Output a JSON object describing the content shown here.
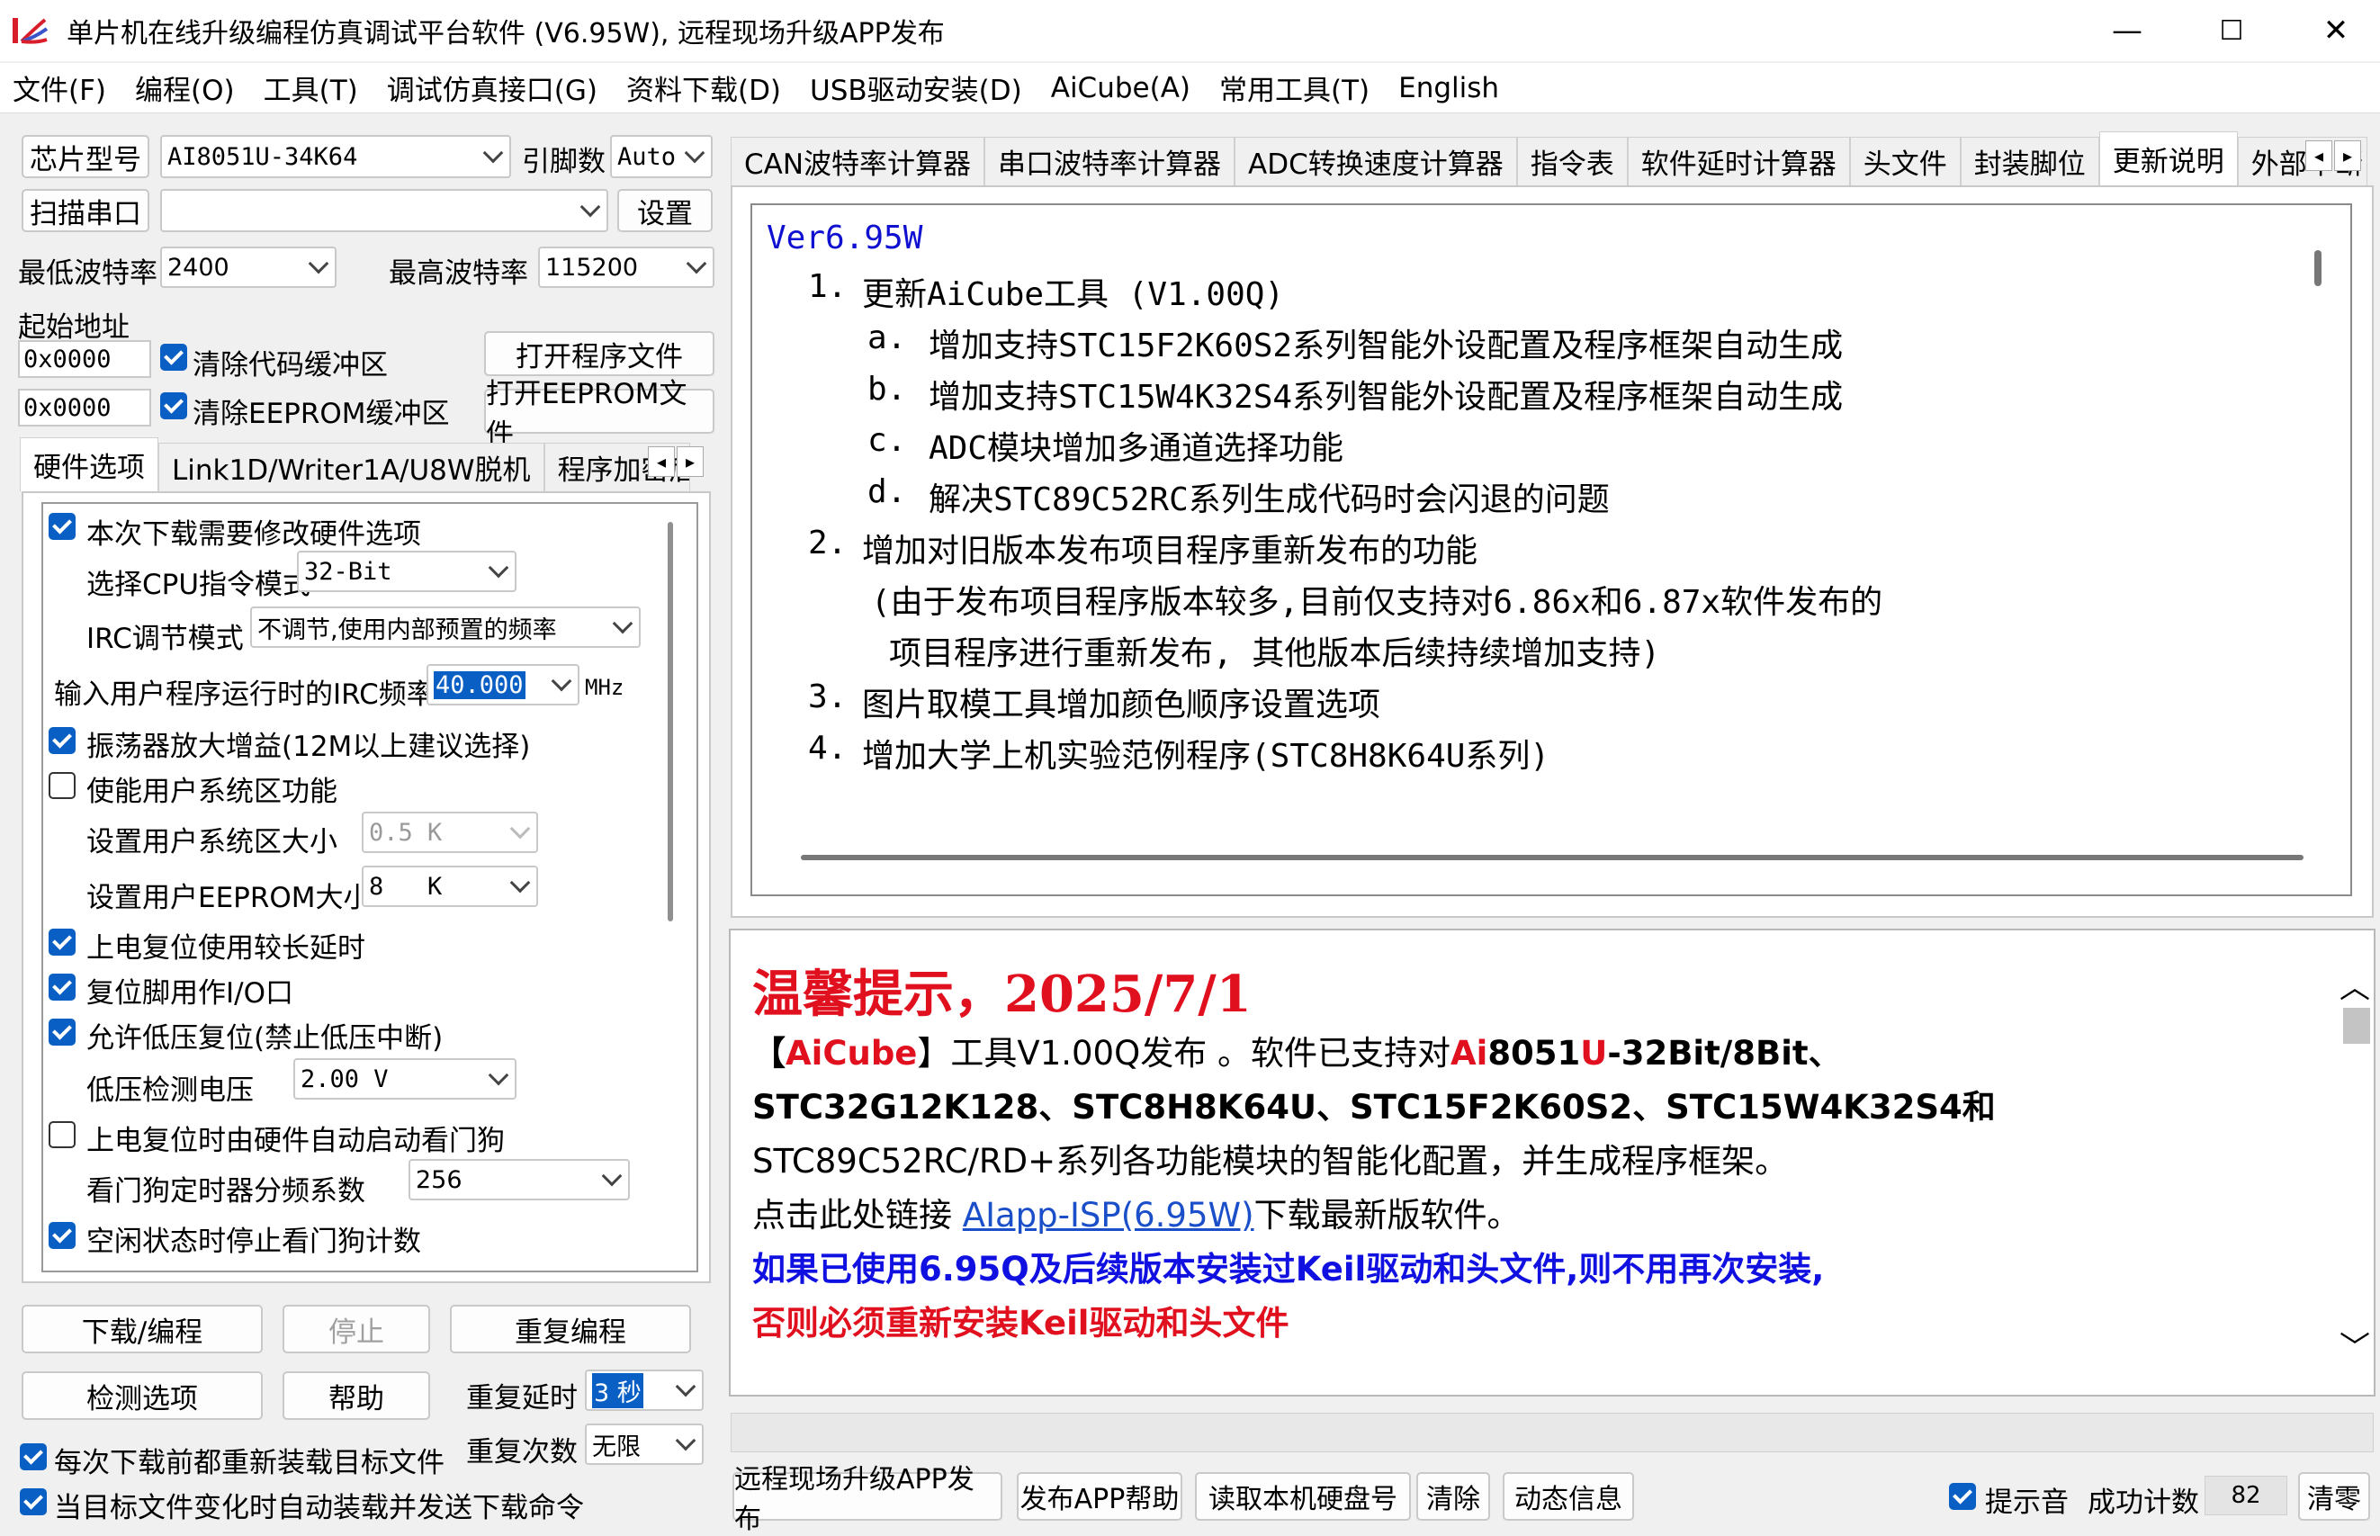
{
  "window": {
    "title": "单片机在线升级编程仿真调试平台软件 (V6.95W), 远程现场升级APP发布",
    "minimize": "—",
    "maximize": "☐",
    "close": "✕"
  },
  "menu": [
    "文件(F)",
    "编程(O)",
    "工具(T)",
    "调试仿真接口(G)",
    "资料下载(D)",
    "USB驱动安装(D)",
    "AiCube(A)",
    "常用工具(T)",
    "English"
  ],
  "left": {
    "chip_label": "芯片型号",
    "chip_value": "AI8051U-34K64",
    "pins_label": "引脚数",
    "pins_value": "Auto",
    "scan_label": "扫描串口",
    "port_value": "",
    "settings_label": "设置",
    "min_baud_label": "最低波特率",
    "min_baud_value": "2400",
    "max_baud_label": "最高波特率",
    "max_baud_value": "115200",
    "start_addr_label": "起始地址",
    "addr1": "0x0000",
    "addr2": "0x0000",
    "clear_code_label": "清除代码缓冲区",
    "clear_eeprom_label": "清除EEPROM缓冲区",
    "open_prog_label": "打开程序文件",
    "open_eeprom_label": "打开EEPROM文件",
    "tabs": [
      "硬件选项",
      "Link1D/Writer1A/U8W脱机",
      "程序加密后"
    ],
    "hw": {
      "modify_label": "本次下载需要修改硬件选项",
      "cpu_mode_label": "选择CPU指令模式",
      "cpu_mode_value": "32-Bit",
      "irc_adj_label": "IRC调节模式",
      "irc_adj_value": "不调节,使用内部预置的频率",
      "irc_freq_label": "输入用户程序运行时的IRC频率",
      "irc_freq_value": "40.000",
      "irc_freq_unit": "MHz",
      "osc_gain_label": "振荡器放大增益(12M以上建议选择)",
      "user_sys_label": "使能用户系统区功能",
      "user_sys_size_label": "设置用户系统区大小",
      "user_sys_size_value": "0.5 K",
      "eeprom_size_label": "设置用户EEPROM大小",
      "eeprom_size_value": "8   K",
      "long_reset_label": "上电复位使用较长延时",
      "reset_pin_label": "复位脚用作I/O口",
      "low_volt_reset_label": "允许低压复位(禁止低压中断)",
      "low_volt_label": "低压检测电压",
      "low_volt_value": "2.00 V",
      "wdt_auto_label": "上电复位时由硬件自动启动看门狗",
      "wdt_div_label": "看门狗定时器分频系数",
      "wdt_div_value": "256",
      "idle_wdt_label": "空闲状态时停止看门狗计数"
    },
    "download_label": "下载/编程",
    "stop_label": "停止",
    "reprogram_label": "重复编程",
    "check_label": "检测选项",
    "help_label": "帮助",
    "repeat_delay_label": "重复延时",
    "repeat_delay_value": "3 秒",
    "repeat_count_label": "重复次数",
    "repeat_count_value": "无限",
    "reload_label": "每次下载前都重新装载目标文件",
    "auto_send_label": "当目标文件变化时自动装载并发送下载命令"
  },
  "right_tabs": [
    "CAN波特率计算器",
    "串口波特率计算器",
    "ADC转换速度计算器",
    "指令表",
    "软件延时计算器",
    "头文件",
    "封装脚位",
    "更新说明",
    "外部中断"
  ],
  "changelog": {
    "version": "Ver6.95W",
    "lines": [
      {
        "num": "1.",
        "text": "更新AiCube工具 (V1.00Q)"
      },
      {
        "num": "a.",
        "text": "增加支持STC15F2K60S2系列智能外设配置及程序框架自动生成"
      },
      {
        "num": "b.",
        "text": "增加支持STC15W4K32S4系列智能外设配置及程序框架自动生成"
      },
      {
        "num": "c.",
        "text": "ADC模块增加多通道选择功能"
      },
      {
        "num": "d.",
        "text": "解决STC89C52RC系列生成代码时会闪退的问题"
      },
      {
        "num": "2.",
        "text": "增加对旧版本发布项目程序重新发布的功能"
      },
      {
        "num": "",
        "text": "(由于发布项目程序版本较多,目前仅支持对6.86x和6.87x软件发布的"
      },
      {
        "num": "",
        "text": "项目程序进行重新发布, 其他版本后续持续增加支持)"
      },
      {
        "num": "3.",
        "text": "图片取模工具增加颜色顺序设置选项"
      },
      {
        "num": "4.",
        "text": "增加大学上机实验范例程序(STC8H8K64U系列)"
      }
    ]
  },
  "notice": {
    "heading": "温馨提示，2025/7/1",
    "l2a": "【",
    "l2b": "AiCube",
    "l2c": "】工具V1.00Q发布 。软件已支持对",
    "l2d": "Ai",
    "l2e": "8051",
    "l2f": "U",
    "l2g": "-32Bit/8Bit、",
    "l3": "STC32G12K128、STC8H8K64U、STC15F2K60S2、STC15W4K32S4和",
    "l4": "STC89C52RC/RD+系列各功能模块的智能化配置，并生成程序框架。",
    "l5a": "点击此处链接 ",
    "l5link": "AIapp-ISP(6.95W)",
    "l5b": "下载最新版软件。",
    "l6": "如果已使用6.95Q及后续版本安装过Keil驱动和头文件,则不用再次安装,",
    "l7": "否则必须重新安装Keil驱动和头文件"
  },
  "bottom": {
    "remote_label": "远程现场升级APP发布",
    "publish_help_label": "发布APP帮助",
    "read_disk_label": "读取本机硬盘号",
    "clear_label": "清除",
    "dynamic_label": "动态信息",
    "sound_label": "提示音",
    "success_label": "成功计数",
    "success_value": "82",
    "reset_count_label": "清零"
  },
  "colors": {
    "accent": "#0a5fc4",
    "red": "#e0101f",
    "blue": "#1010e0",
    "link": "#1a4fc9"
  }
}
